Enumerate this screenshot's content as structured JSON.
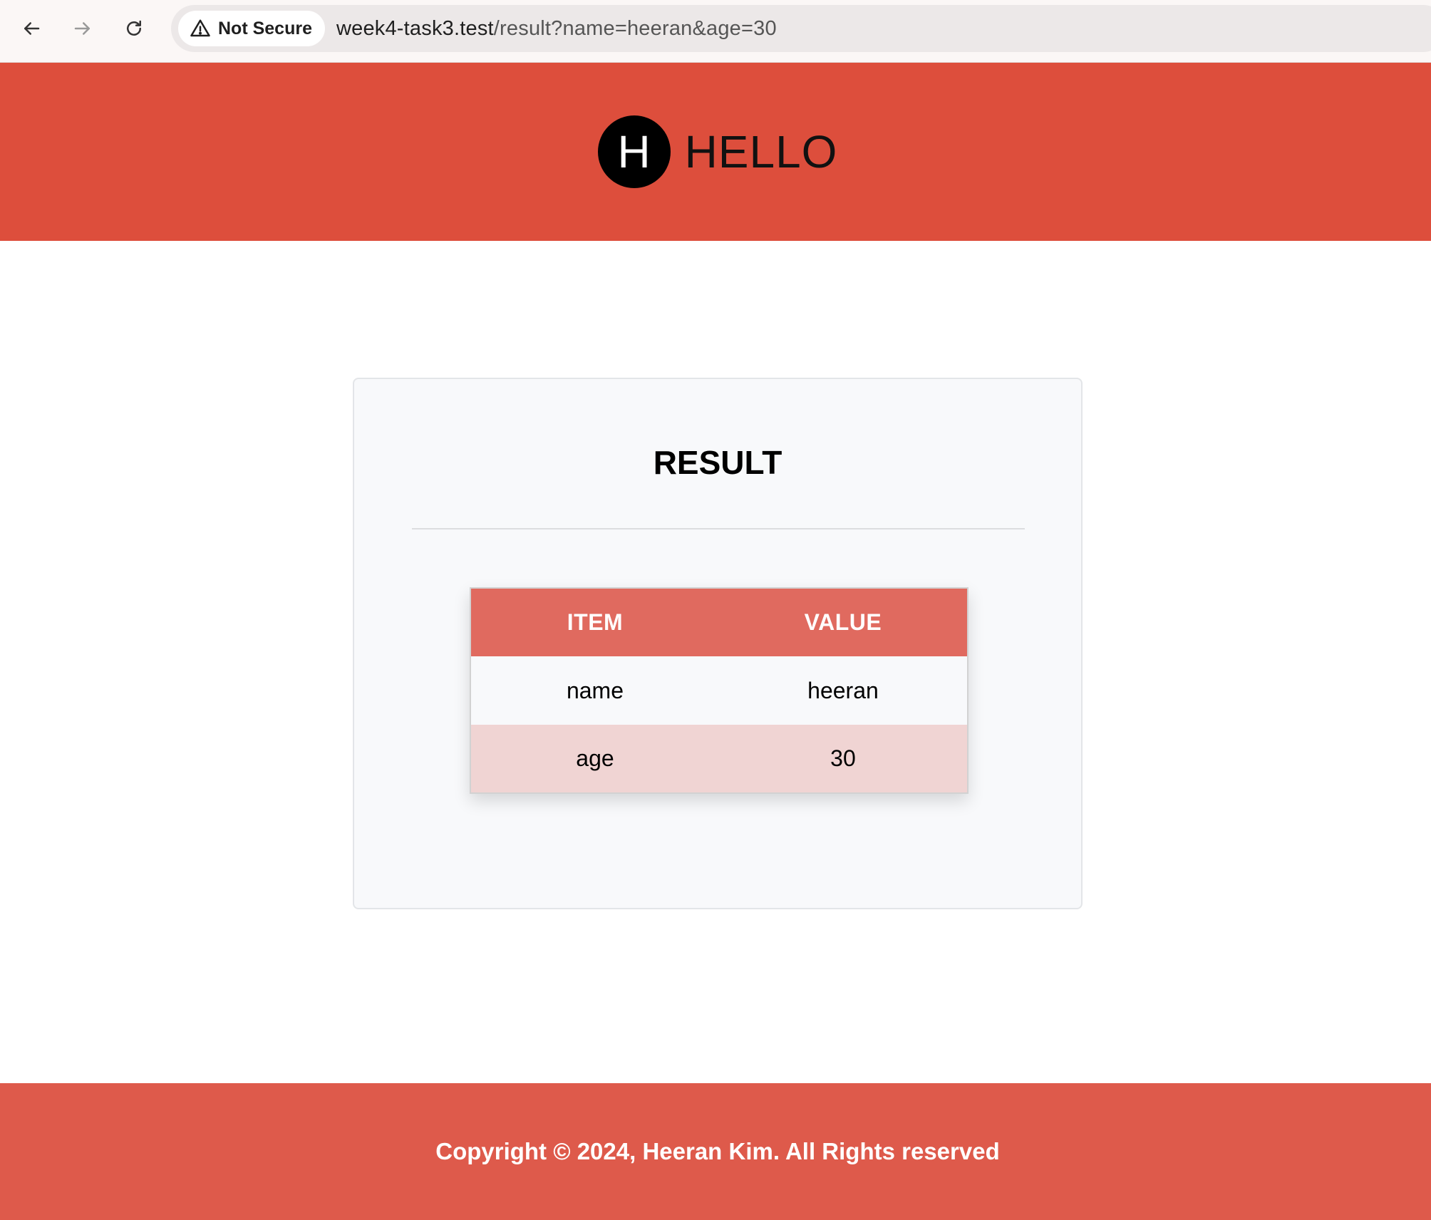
{
  "browser": {
    "security_label": "Not Secure",
    "url_host": "week4-task3.test",
    "url_path": "/result?name=heeran&age=30"
  },
  "header": {
    "logo_letter": "H",
    "brand_name": "HELLO",
    "background_color": "#dd4e3c"
  },
  "result": {
    "title": "RESULT",
    "columns": [
      "ITEM",
      "VALUE"
    ],
    "rows": [
      [
        "name",
        "heeran"
      ],
      [
        "age",
        "30"
      ]
    ]
  },
  "footer": {
    "copyright": "Copyright © 2024, Heeran Kim. All Rights reserved",
    "background_color": "#de5a4b"
  }
}
